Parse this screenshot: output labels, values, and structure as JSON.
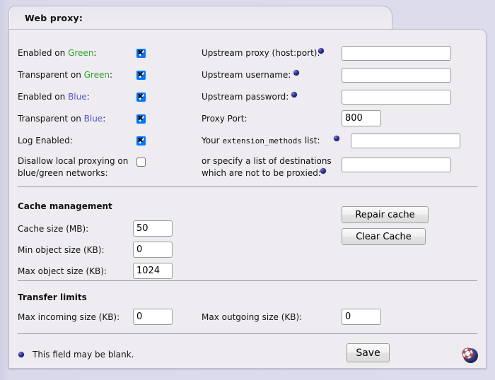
{
  "tab": {
    "title": "Web proxy:"
  },
  "left_column": {
    "rows": [
      {
        "label_pre": "Enabled on ",
        "label_color": "Green",
        "label_post": ":",
        "color_class": "grn",
        "checked": true,
        "name": "enabled-on-green"
      },
      {
        "label_pre": "Transparent on ",
        "label_color": "Green",
        "label_post": ":",
        "color_class": "grn",
        "checked": true,
        "name": "transparent-on-green"
      },
      {
        "label_pre": "Enabled on ",
        "label_color": "Blue",
        "label_post": ":",
        "color_class": "blu",
        "checked": true,
        "name": "enabled-on-blue"
      },
      {
        "label_pre": "Transparent on ",
        "label_color": "Blue",
        "label_post": ":",
        "color_class": "blu",
        "checked": true,
        "name": "transparent-on-blue"
      },
      {
        "label_pre": "Log Enabled:",
        "label_color": "",
        "label_post": "",
        "color_class": "",
        "checked": true,
        "name": "log-enabled"
      }
    ],
    "disallow": {
      "line1": "Disallow local proxying on",
      "line2": "blue/green networks:",
      "checked": false
    }
  },
  "right_column": {
    "upstream_proxy": {
      "label": "Upstream proxy (host:port):",
      "value": "",
      "blank_ok": true
    },
    "upstream_username": {
      "label": "Upstream username:",
      "value": "",
      "blank_ok": true
    },
    "upstream_password": {
      "label": "Upstream password:",
      "value": "",
      "blank_ok": true
    },
    "proxy_port": {
      "label": "Proxy Port:",
      "value": "800",
      "blank_ok": false
    },
    "extension_methods": {
      "label_pre": "Your ",
      "label_mono": "extension_methods",
      "label_post": " list:",
      "value": "",
      "blank_ok": true
    },
    "no_proxy": {
      "line1": "or specify a list of destinations",
      "line2": "which are not to be proxied:",
      "value": "",
      "blank_ok": true
    }
  },
  "cache": {
    "title": "Cache management",
    "cache_size": {
      "label": "Cache size (MB):",
      "value": "50"
    },
    "min_object_size": {
      "label": "Min object size (KB):",
      "value": "0"
    },
    "max_object_size": {
      "label": "Max object size (KB):",
      "value": "1024"
    },
    "repair_button": "Repair cache",
    "clear_button": "Clear Cache"
  },
  "transfer": {
    "title": "Transfer limits",
    "max_incoming": {
      "label": "Max incoming size (KB):",
      "value": "0"
    },
    "max_outgoing": {
      "label": "Max outgoing size (KB):",
      "value": "0"
    }
  },
  "footer": {
    "legend": "This field may be blank.",
    "save_button": "Save",
    "help_icon": "lifebuoy-help-icon"
  },
  "colors": {
    "green_label": "#2aa32a",
    "blue_label": "#5555cc",
    "bullet": "#1c1c7a",
    "page_background": "#d9d9e8",
    "panel_background": "#eeecf0"
  }
}
